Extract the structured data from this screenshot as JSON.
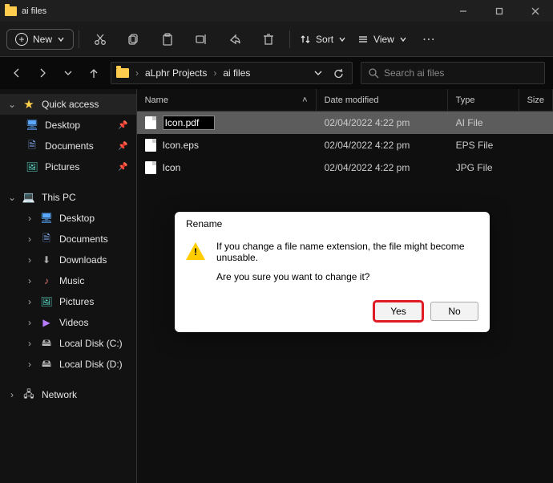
{
  "titlebar": {
    "title": "ai files"
  },
  "toolbar": {
    "new_label": "New",
    "sort_label": "Sort",
    "view_label": "View"
  },
  "breadcrumb": {
    "seg1": "aLphr Projects",
    "seg2": "ai files"
  },
  "search": {
    "placeholder": "Search ai files"
  },
  "sidebar": {
    "quick_access": "Quick access",
    "desktop": "Desktop",
    "documents": "Documents",
    "pictures": "Pictures",
    "this_pc": "This PC",
    "pc_desktop": "Desktop",
    "pc_documents": "Documents",
    "pc_downloads": "Downloads",
    "pc_music": "Music",
    "pc_pictures": "Pictures",
    "pc_videos": "Videos",
    "disk_c": "Local Disk (C:)",
    "disk_d": "Local Disk (D:)",
    "network": "Network"
  },
  "columns": {
    "name": "Name",
    "date": "Date modified",
    "type": "Type",
    "size": "Size"
  },
  "files": {
    "r0": {
      "name": "Icon.pdf",
      "date": "02/04/2022 4:22 pm",
      "type": "AI File"
    },
    "r1": {
      "name": "Icon.eps",
      "date": "02/04/2022 4:22 pm",
      "type": "EPS File"
    },
    "r2": {
      "name": "Icon",
      "date": "02/04/2022 4:22 pm",
      "type": "JPG File"
    }
  },
  "dialog": {
    "title": "Rename",
    "line1": "If you change a file name extension, the file might become unusable.",
    "line2": "Are you sure you want to change it?",
    "yes": "Yes",
    "no": "No"
  }
}
